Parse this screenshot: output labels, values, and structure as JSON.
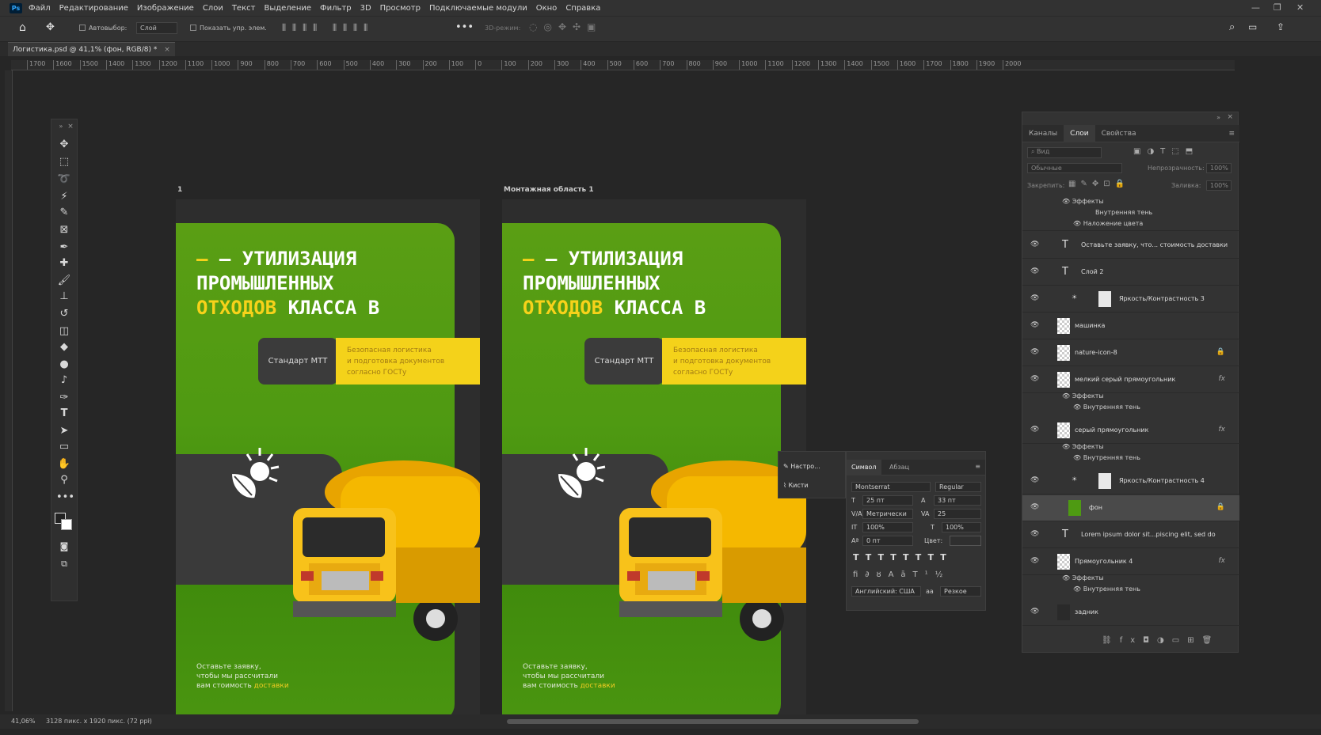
{
  "menu": {
    "logo": "Ps",
    "items": [
      "Файл",
      "Редактирование",
      "Изображение",
      "Слои",
      "Текст",
      "Выделение",
      "Фильтр",
      "3D",
      "Просмотр",
      "Подключаемые модули",
      "Окно",
      "Справка"
    ]
  },
  "options": {
    "autoselect_label": "Автовыбор:",
    "autoselect_value": "Слой",
    "show_controls_label": "Показать упр. элем.",
    "mode_3d": "3D-режим:"
  },
  "document": {
    "tab": "Логистика.psd @ 41,1% (фон, RGB/8) *"
  },
  "ruler_ticks": [
    "1700",
    "1600",
    "1500",
    "1400",
    "1300",
    "1200",
    "1100",
    "1000",
    "900",
    "800",
    "700",
    "600",
    "500",
    "400",
    "300",
    "200",
    "100",
    "0",
    "100",
    "200",
    "300",
    "400",
    "500",
    "600",
    "700",
    "800",
    "900",
    "1000",
    "1100",
    "1200",
    "1300",
    "1400",
    "1500",
    "1600",
    "1700",
    "1800",
    "1900",
    "2000"
  ],
  "artboards": [
    {
      "title": "1"
    },
    {
      "title": "Монтажная область 1"
    }
  ],
  "poster": {
    "line1": "— УТИЛИЗАЦИЯ",
    "line2": "ПРОМЫШЛЕННЫХ",
    "line3_highlight": "ОТХОДОВ",
    "line3_rest": " КЛАССА В",
    "standard": "Стандарт МТТ",
    "yellow_line1": "Безопасная логистика",
    "yellow_line2": "и подготовка документов",
    "yellow_line3": "согласно ГОСТу",
    "footer_line1": "Оставьте заявку,",
    "footer_line2": "чтобы мы рассчитали",
    "footer_line3_prefix": "вам стоимость ",
    "footer_line3_highlight": "доставки"
  },
  "layers_panel": {
    "tabs": [
      "Каналы",
      "Слои",
      "Свойства"
    ],
    "active_tab": "Слои",
    "search_placeholder": "Вид",
    "blend_mode": "Обычные",
    "opacity_label": "Непрозрачность:",
    "opacity_value": "100%",
    "lock_label": "Закрепить:",
    "fill_label": "Заливка:",
    "fill_value": "100%",
    "top_effects": {
      "label": "Эффекты",
      "items": [
        "Внутренняя тень",
        "Наложение цвета"
      ]
    },
    "layers": [
      {
        "name": "Оставьте заявку, что... стоимость доставки",
        "kind": "text"
      },
      {
        "name": "Слой 2",
        "kind": "text"
      },
      {
        "name": "Яркость/Контрастность 3",
        "kind": "adjust"
      },
      {
        "name": "машинка",
        "kind": "image"
      },
      {
        "name": "nature-icon-8",
        "kind": "image",
        "locked": true
      },
      {
        "name": "мелкий серый прямоугольник",
        "kind": "shape",
        "fx": true,
        "effects": [
          "Эффекты",
          "Внутренняя тень"
        ]
      },
      {
        "name": "серый прямоугольник",
        "kind": "shape",
        "fx": true,
        "effects": [
          "Эффекты",
          "Внутренняя тень"
        ]
      },
      {
        "name": "Яркость/Контрастность 4",
        "kind": "adjust"
      },
      {
        "name": "фон",
        "kind": "green",
        "locked": true,
        "selected": true
      },
      {
        "name": "Lorem ipsum dolor sit...piscing elit, sed do",
        "kind": "text"
      },
      {
        "name": "Прямоугольник 4",
        "kind": "shape",
        "fx": true,
        "effects": [
          "Эффекты",
          "Внутренняя тень"
        ]
      },
      {
        "name": "задник",
        "kind": "dark"
      }
    ]
  },
  "brush_panel": {
    "items": [
      "Настро...",
      "Кисти"
    ]
  },
  "character_panel": {
    "tabs": [
      "Символ",
      "Абзац"
    ],
    "font": "Montserrat",
    "style": "Regular",
    "size": "25 пт",
    "leading": "33 пт",
    "kerning": "Метрически",
    "tracking": "25",
    "vscale": "100%",
    "hscale": "100%",
    "baseline": "0 пт",
    "color_label": "Цвет:",
    "language": "Английский: США",
    "antialias": "Резкое",
    "aa_glyph": "aa"
  },
  "status": {
    "zoom": "41,06%",
    "size": "3128 пикс. x 1920 пикс. (72 ppi)"
  }
}
